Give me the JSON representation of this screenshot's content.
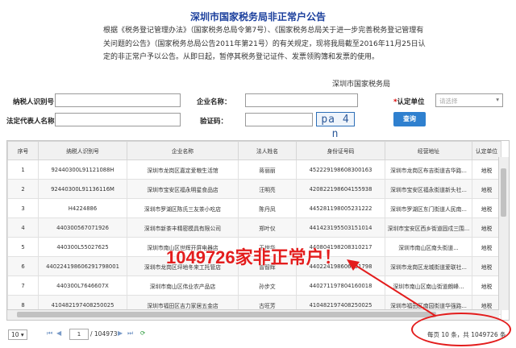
{
  "title": "深圳市国家税务局非正常户公告",
  "notice": "根据《税务登记管理办法》（国家税务总局令第7号）、《国家税务总局关于进一步完善税务登记管理有关问题的公告》（国家税务总局公告2011年第21号）的有关规定，现将我局截至2016年11月25日认定的非正常户予以公告。从即日起，暂停其税务登记证件、发票领购簿和发票的使用。",
  "signature": "深圳市国家税务局",
  "form": {
    "taxpayer_id_label": "纳税人识别号：",
    "company_name_label": "企业名称：",
    "legal_rep_label": "法定代表人名称：",
    "captcha_label": "验证码：",
    "unit_label": "认定单位",
    "unit_required": "*",
    "unit_placeholder": "请选择",
    "captcha_text": "pa 4 n",
    "query_button": "查询"
  },
  "table": {
    "columns": [
      "序号",
      "纳税人识别号",
      "企业名称",
      "法人姓名",
      "身份证号码",
      "经营地址",
      "认定单位"
    ],
    "rows": [
      [
        "1",
        "92440300L91121088H",
        "深圳市龙岗区嘉定爱粮生活馆",
        "蒋丽丽",
        "452229198608300163",
        "深圳市龙岗区布吉街道吉华路...",
        "地税"
      ],
      [
        "2",
        "92440300L91136116M",
        "深圳市宝安区福永明星食品店",
        "汪明亮",
        "420822198604155938",
        "深圳市宝安区福永街道新头社...",
        "地税"
      ],
      [
        "3",
        "H4224886",
        "深圳市罗湖区陈氏三友茶小吃店",
        "陈丹凤",
        "445281198005231222",
        "深圳市罗湖区东门街道人民南...",
        "地税"
      ],
      [
        "4",
        "440300567071926",
        "深圳市新茶丰精密模具有限公司",
        "郑叶仪",
        "441423195503151014",
        "深圳市宝安区西乡街道固戍三围...",
        "地税"
      ],
      [
        "5",
        "440300L55027625",
        "深圳市南山区世辉开屏电器店",
        "王世华",
        "440804198208310217",
        "深圳市南山区南头街道...",
        "地税"
      ],
      [
        "6",
        "440224198606291798001",
        "深圳市龙岗区坪地冬来工托管店",
        "曾智辉",
        "440224198606291798",
        "深圳市龙岗区龙城街道爱联社...",
        "地税"
      ],
      [
        "7",
        "440300L7646607X",
        "深圳市南山区伟业农产品店",
        "孙步文",
        "440271197804160018",
        "深圳市南山区南山街道朗峰...",
        "地税"
      ],
      [
        "8",
        "410482197408250025",
        "深圳市福田区吉力家居五金店",
        "古旺芳",
        "410482197408250025",
        "深圳市福田区南园街道华强路...",
        "地税"
      ],
      [
        "9",
        "360311199303260570",
        "深圳市龙岗区宏达鞋业商行",
        "廖明贤",
        "360311199303260570",
        "深圳市龙岗区坪地街道年丰路...",
        "地税"
      ],
      [
        "10",
        "92440300L9104326X7",
        "深圳市南山区西园林鸿发服饰店",
        "林鸿发",
        "440583198101162217",
        "深圳市南山区西丽街道新围村...",
        "地税"
      ]
    ]
  },
  "pager": {
    "page_size": "10",
    "current_page": "1",
    "total_pages_text": "/ 104973",
    "summary": "每页 10 条，共 1049726 条"
  },
  "overlay": {
    "text": "1049726家非正常户！",
    "color": "#e31d1d"
  },
  "colors": {
    "title": "#1a3e9c",
    "button": "#2f80cf",
    "annotation": "#e31d1d"
  }
}
